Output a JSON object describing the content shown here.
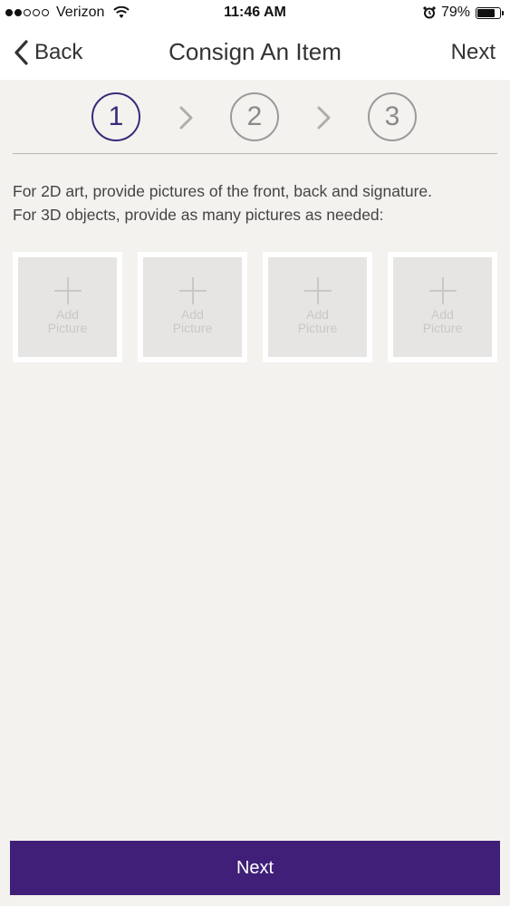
{
  "status_bar": {
    "carrier": "Verizon",
    "time": "11:46 AM",
    "battery_percent": "79%",
    "battery_level": 0.79,
    "signal_strength": 2,
    "signal_total": 5
  },
  "nav": {
    "back_label": "Back",
    "title": "Consign An Item",
    "next_label": "Next"
  },
  "steps": [
    {
      "number": "1",
      "active": true
    },
    {
      "number": "2",
      "active": false
    },
    {
      "number": "3",
      "active": false
    }
  ],
  "instructions": {
    "line1": "For 2D art, provide pictures of the front, back and signature.",
    "line2": "For 3D objects, provide as many pictures as needed:"
  },
  "picture_tiles": [
    {
      "label_line1": "Add",
      "label_line2": "Picture"
    },
    {
      "label_line1": "Add",
      "label_line2": "Picture"
    },
    {
      "label_line1": "Add",
      "label_line2": "Picture"
    },
    {
      "label_line1": "Add",
      "label_line2": "Picture"
    }
  ],
  "footer": {
    "next_label": "Next"
  },
  "colors": {
    "accent": "#3f1f78",
    "step_active": "#3c2a7a",
    "background": "#f4f2ef"
  },
  "icons": {
    "back": "chevron-left-icon",
    "step_separator": "chevron-right-icon",
    "add": "plus-icon",
    "wifi": "wifi-icon",
    "alarm": "alarm-icon",
    "battery": "battery-icon"
  }
}
